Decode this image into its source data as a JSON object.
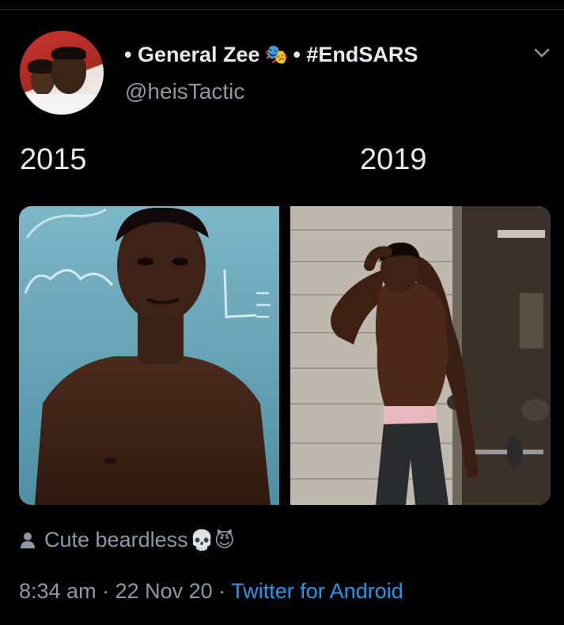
{
  "tweet": {
    "display_name_prefix": "• General Zee",
    "name_emoji": "🎭",
    "display_name_suffix": "• #EndSARS",
    "handle": "@heisTactic",
    "photo_labels": [
      "2015",
      "2019"
    ],
    "caption_text": "Cute beardless",
    "caption_emojis": "💀😈",
    "time": "8:34 am",
    "date": "22 Nov 20",
    "separator": "·",
    "source": "Twitter for Android"
  },
  "icons": {
    "more": "chevron-down-icon",
    "caption": "person-icon"
  },
  "colors": {
    "background": "#000000",
    "primary_text": "#e7e9ea",
    "secondary_text": "#8b98a5",
    "link": "#1d9bf0"
  }
}
